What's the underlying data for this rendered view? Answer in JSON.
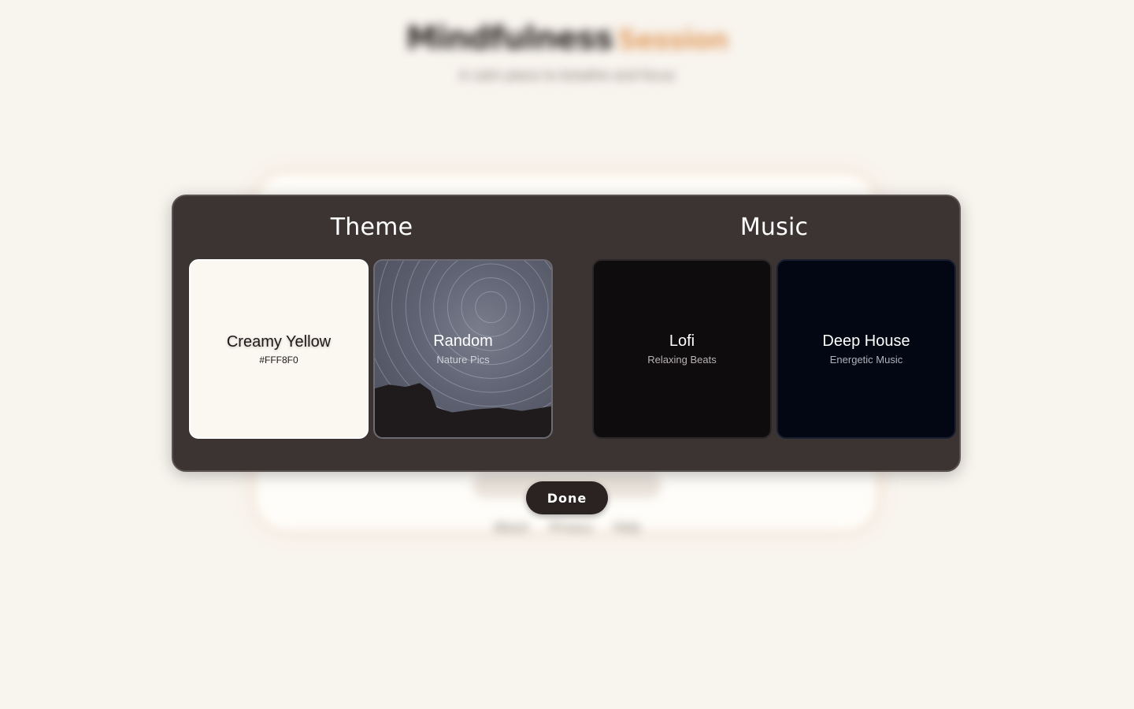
{
  "background": {
    "title": "Mindfulness",
    "title_accent": "Session",
    "subtitle": "A calm place to breathe and focus",
    "footer": "About Privacy Help"
  },
  "modal": {
    "theme_title": "Theme",
    "music_title": "Music",
    "themes": [
      {
        "name": "Creamy Yellow",
        "sub": "#FFF8F0",
        "color": "#fff8f0"
      },
      {
        "name": "Random",
        "sub": "Nature Pics"
      }
    ],
    "music": [
      {
        "name": "Lofi",
        "sub": "Relaxing Beats",
        "color": "#0e0c0d"
      },
      {
        "name": "Deep House",
        "sub": "Energetic Music",
        "color": "#020713"
      }
    ]
  },
  "done_label": "Done",
  "colors": {
    "page_background": "#f8f4ee",
    "modal_background": "#302928",
    "accent": "#e2a066",
    "button": "#2b2322"
  }
}
